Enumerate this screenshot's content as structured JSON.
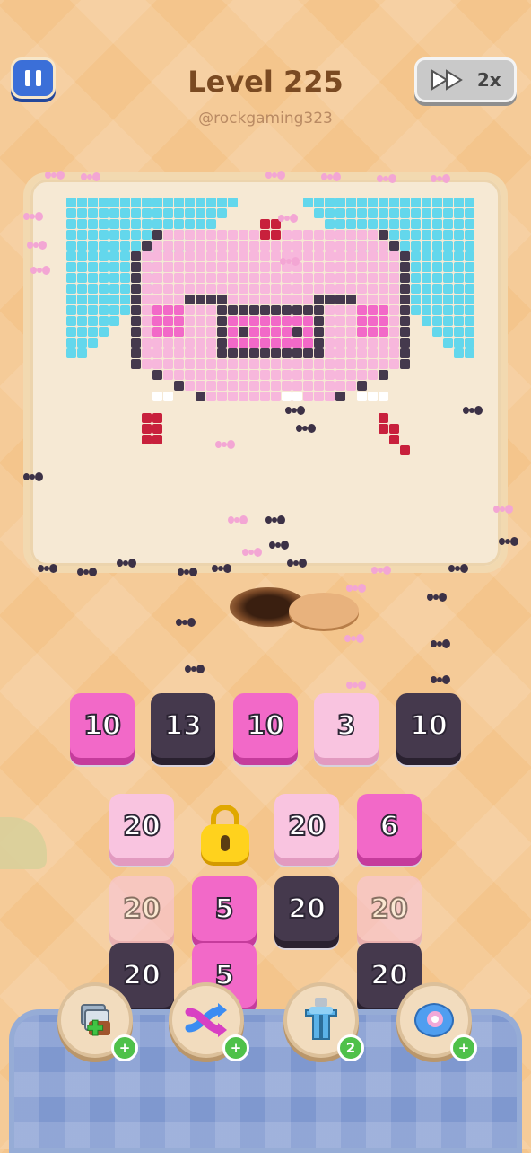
{
  "header": {
    "level_title": "Level 225",
    "username": "@rockgaming323",
    "speed_label": "2x"
  },
  "queue": [
    {
      "value": "10",
      "color": "hot"
    },
    {
      "value": "13",
      "color": "dark"
    },
    {
      "value": "10",
      "color": "hot"
    },
    {
      "value": "3",
      "color": "pale"
    },
    {
      "value": "10",
      "color": "dark"
    }
  ],
  "grid": {
    "row1": [
      {
        "value": "20",
        "color": "pale"
      },
      {
        "value": "",
        "color": "lock"
      },
      {
        "value": "20",
        "color": "pale"
      },
      {
        "value": "6",
        "color": "hot"
      }
    ],
    "row2": [
      {
        "value": "20",
        "color": "pale",
        "dim": true
      },
      {
        "value": "5",
        "color": "hot"
      },
      {
        "value": "20",
        "color": "dark"
      },
      {
        "value": "20",
        "color": "pale",
        "dim": true
      }
    ],
    "row3": [
      {
        "value": "20",
        "color": "dark"
      },
      {
        "value": "5",
        "color": "hot"
      },
      {
        "value": "",
        "color": "empty"
      },
      {
        "value": "20",
        "color": "dark"
      }
    ]
  },
  "boosters": [
    {
      "icon": "add-tile-icon",
      "badge": "+"
    },
    {
      "icon": "shuffle-icon",
      "badge": "+"
    },
    {
      "icon": "magnet-icon",
      "badge": "2"
    },
    {
      "icon": "donut-icon",
      "badge": "+"
    }
  ],
  "colors": {
    "pink": "#f7b7dc",
    "hot_pink": "#f269c8",
    "dark": "#45394d",
    "cyan": "#63d7ec",
    "red": "#c8203c"
  }
}
